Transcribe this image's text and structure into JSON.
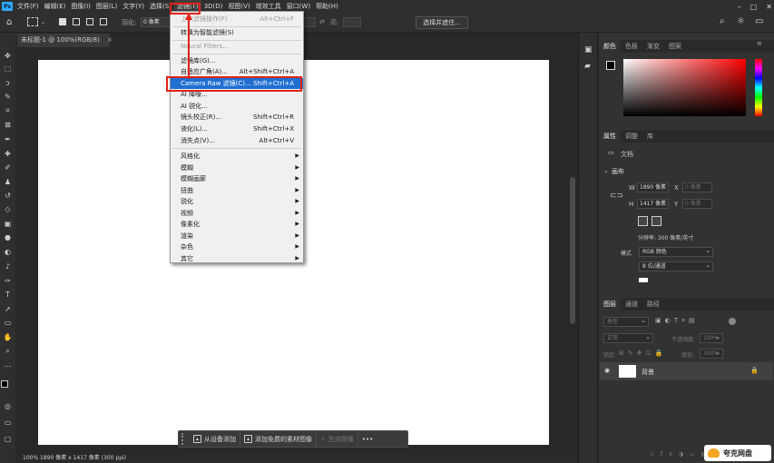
{
  "app": {
    "logo": "Ps"
  },
  "menu": {
    "items": [
      "文件(F)",
      "编辑(E)",
      "图像(I)",
      "图层(L)",
      "文字(Y)",
      "选择(S)",
      "滤镜(T)",
      "3D(D)",
      "视图(V)",
      "增效工具",
      "窗口(W)",
      "帮助(H)"
    ]
  },
  "window_controls": [
    "–",
    "□",
    "✕"
  ],
  "options": {
    "feather_label": "羽化:",
    "feather_value": "0 像素",
    "width_label": "宽:",
    "height_label": "高:",
    "select_subject": "选择并遮住..."
  },
  "document": {
    "tab_title": "未标题-1 @ 100%(RGB/8)",
    "status": "100%    1890 像素 x 1417 像素 (300 ppi)"
  },
  "filter_menu": {
    "items": [
      {
        "label": "上次滤镜操作(F)",
        "shortcut": "Alt+Ctrl+F",
        "disabled": true
      },
      {
        "label": "转换为智能滤镜(S)",
        "shortcut": ""
      },
      {
        "label": "Neural Filters...",
        "shortcut": "",
        "disabled": true
      },
      {
        "label": "滤镜库(G)...",
        "shortcut": ""
      },
      {
        "label": "自适应广角(A)...",
        "shortcut": "Alt+Shift+Ctrl+A"
      },
      {
        "label": "Camera Raw 滤镜(C)...",
        "shortcut": "Shift+Ctrl+A",
        "highlighted": true
      },
      {
        "label": "AI 降噪...",
        "shortcut": ""
      },
      {
        "label": "AI 锐化...",
        "shortcut": ""
      },
      {
        "label": "镜头校正(R)...",
        "shortcut": "Shift+Ctrl+R"
      },
      {
        "label": "液化(L)...",
        "shortcut": "Shift+Ctrl+X"
      },
      {
        "label": "消失点(V)...",
        "shortcut": "Alt+Ctrl+V"
      },
      {
        "label": "风格化",
        "submenu": true
      },
      {
        "label": "模糊",
        "submenu": true
      },
      {
        "label": "模糊画廊",
        "submenu": true
      },
      {
        "label": "扭曲",
        "submenu": true
      },
      {
        "label": "锐化",
        "submenu": true
      },
      {
        "label": "视频",
        "submenu": true
      },
      {
        "label": "像素化",
        "submenu": true
      },
      {
        "label": "渲染",
        "submenu": true
      },
      {
        "label": "杂色",
        "submenu": true
      },
      {
        "label": "其它",
        "submenu": true
      }
    ]
  },
  "context_bar": {
    "add_from_device": "从设备添加",
    "add_free_assets": "添加免费的素材图像",
    "generate_image": "生成图像",
    "more": "•••"
  },
  "color_panel": {
    "tabs": [
      "颜色",
      "色板",
      "渐变",
      "图案"
    ]
  },
  "properties_panel": {
    "tabs": [
      "属性",
      "调整",
      "库"
    ],
    "doc_label": "文档",
    "canvas_section": "画布",
    "w_label": "W",
    "w_value": "1890 像素",
    "h_label": "H",
    "h_value": "1417 像素",
    "x_label": "X",
    "x_placeholder": "0 像素",
    "y_label": "Y",
    "y_placeholder": "0 像素",
    "resolution": "分辨率: 300 像素/英寸",
    "mode_label": "模式",
    "mode_value": "RGB 颜色",
    "depth_value": "8 位/通道"
  },
  "layers_panel": {
    "tabs": [
      "图层",
      "通道",
      "路径"
    ],
    "filter_placeholder": "类型",
    "blend_mode": "正常",
    "opacity_label": "不透明度:",
    "opacity_value": "100%",
    "lock_label": "锁定:",
    "fill_label": "填充:",
    "fill_value": "100%",
    "background_layer": "背景"
  },
  "brand_badge": "夸克网盘"
}
